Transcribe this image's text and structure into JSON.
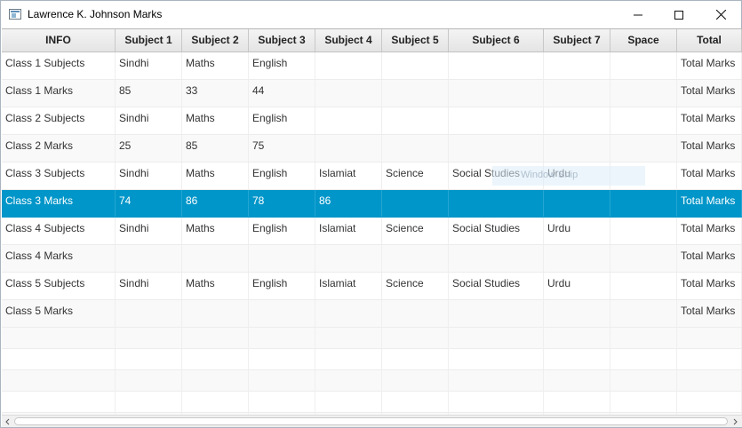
{
  "window": {
    "title": "Lawrence K. Johnson Marks"
  },
  "columns": [
    "INFO",
    "Subject 1",
    "Subject 2",
    "Subject 3",
    "Subject 4",
    "Subject 5",
    "Subject 6",
    "Subject 7",
    "Space",
    "Total"
  ],
  "rows": [
    {
      "cells": [
        "Class 1 Subjects",
        "Sindhi",
        "Maths",
        "English",
        "",
        "",
        "",
        "",
        "",
        "Total Marks"
      ]
    },
    {
      "cells": [
        "Class 1 Marks",
        "85",
        "33",
        "44",
        "",
        "",
        "",
        "",
        "",
        "Total Marks"
      ]
    },
    {
      "cells": [
        "Class 2 Subjects",
        "Sindhi",
        "Maths",
        "English",
        "",
        "",
        "",
        "",
        "",
        "Total Marks"
      ]
    },
    {
      "cells": [
        "Class 2 Marks",
        "25",
        "85",
        "75",
        "",
        "",
        "",
        "",
        "",
        "Total Marks"
      ]
    },
    {
      "cells": [
        "Class 3 Subjects",
        "Sindhi",
        "Maths",
        "English",
        "Islamiat",
        "Science",
        "Social Studies",
        "Urdu",
        "",
        "Total Marks"
      ]
    },
    {
      "cells": [
        "Class 3 Marks",
        "74",
        "86",
        "78",
        "86",
        "",
        "",
        "",
        "",
        "Total Marks"
      ],
      "selected": true
    },
    {
      "cells": [
        "Class 4 Subjects",
        "Sindhi",
        "Maths",
        "English",
        "Islamiat",
        "Science",
        "Social Studies",
        "Urdu",
        "",
        "Total Marks"
      ]
    },
    {
      "cells": [
        "Class 4 Marks",
        "",
        "",
        "",
        "",
        "",
        "",
        "",
        "",
        "Total Marks"
      ]
    },
    {
      "cells": [
        "Class 5 Subjects",
        "Sindhi",
        "Maths",
        "English",
        "Islamiat",
        "Science",
        "Social Studies",
        "Urdu",
        "",
        "Total Marks"
      ]
    },
    {
      "cells": [
        "Class 5 Marks",
        "",
        "",
        "",
        "",
        "",
        "",
        "",
        "",
        "Total Marks"
      ]
    }
  ],
  "overlay_text": "Window Snip",
  "colors": {
    "selection": "#0096c9",
    "header": "#e9e9e9"
  },
  "icons": {
    "app": "window-app-icon",
    "minimize": "minimize-icon",
    "maximize": "maximize-icon",
    "close": "close-icon"
  }
}
